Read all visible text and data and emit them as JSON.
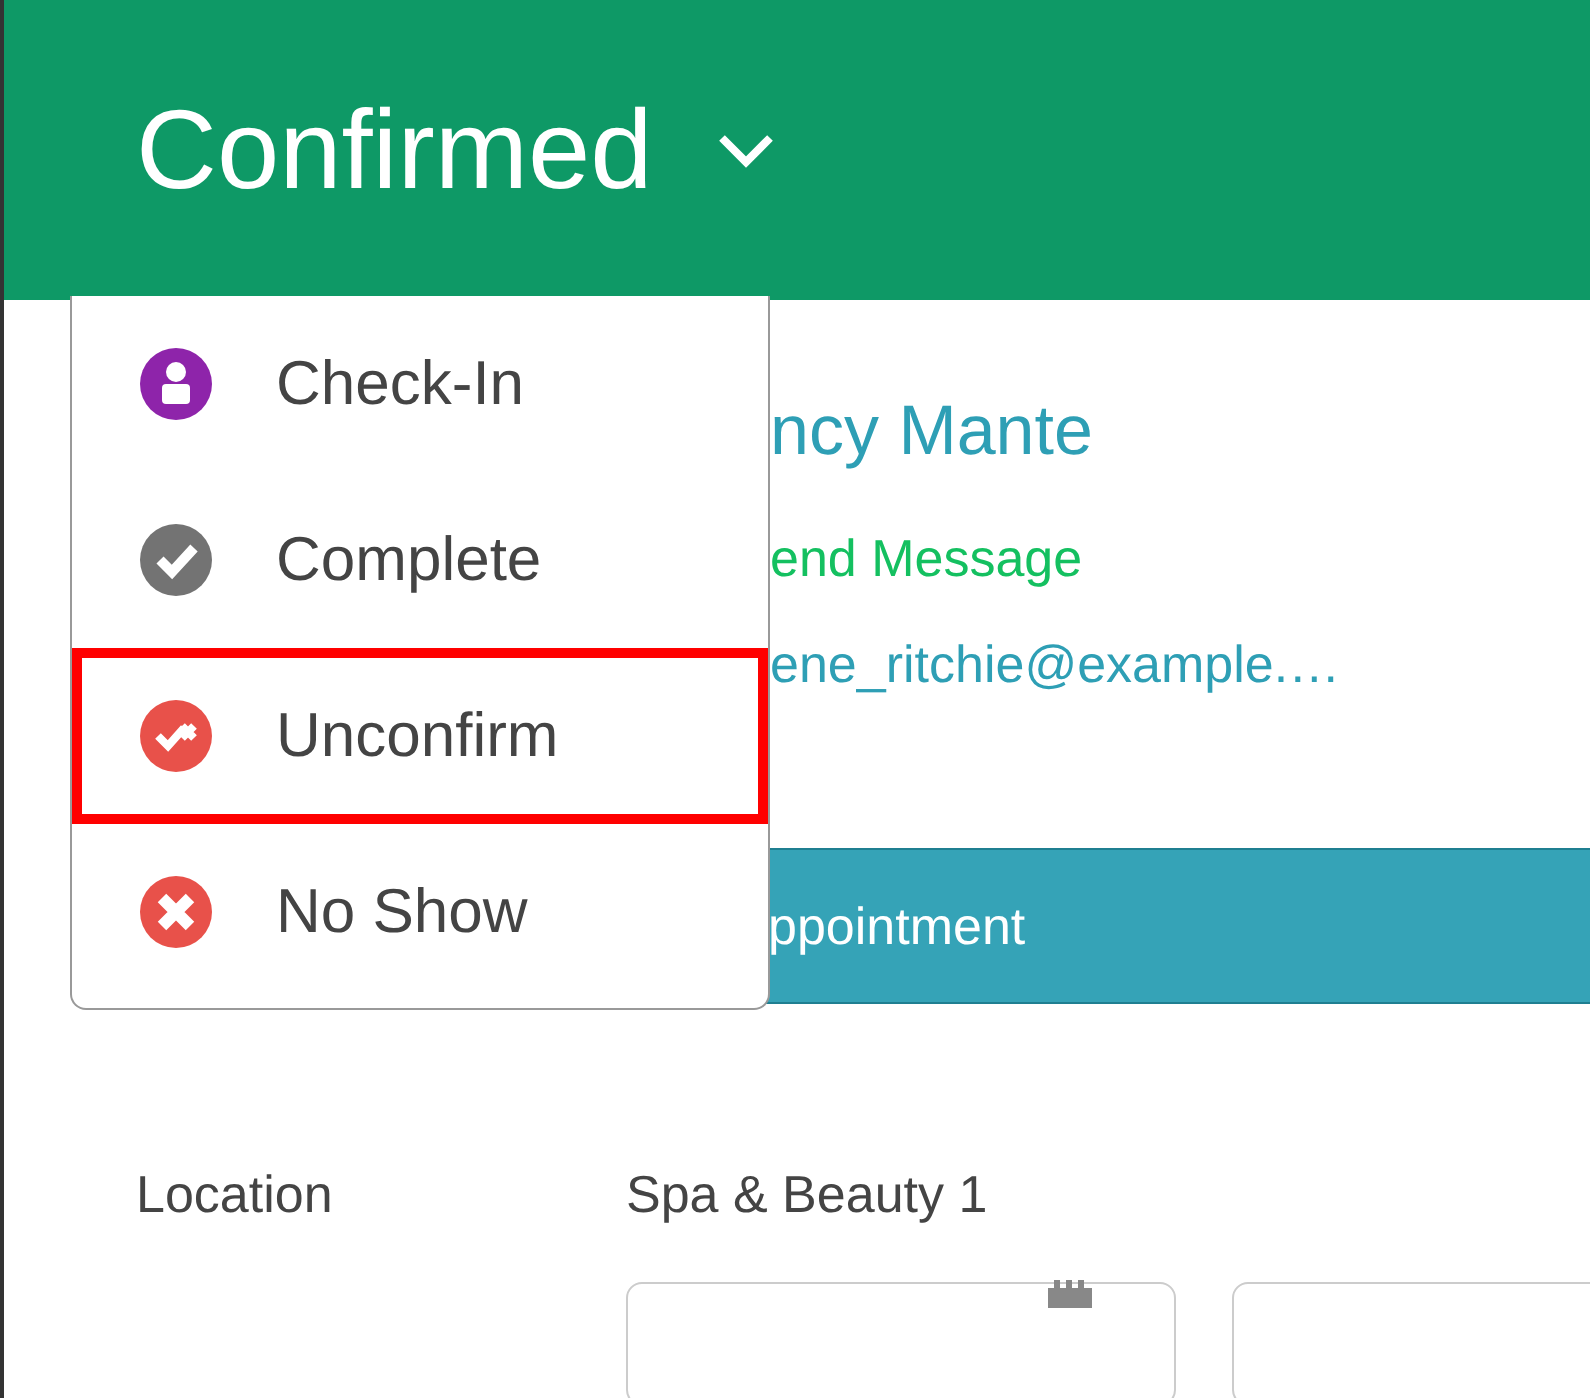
{
  "header": {
    "status": "Confirmed"
  },
  "menu": {
    "items": [
      {
        "label": "Check-In",
        "kind": "person",
        "color": "#8e24aa",
        "highlighted": false
      },
      {
        "label": "Complete",
        "kind": "check",
        "color": "#737373",
        "highlighted": false
      },
      {
        "label": "Unconfirm",
        "kind": "uncheck",
        "color": "#e8514a",
        "highlighted": true
      },
      {
        "label": "No Show",
        "kind": "cross",
        "color": "#e8514a",
        "highlighted": false
      }
    ]
  },
  "client": {
    "name": "ncy Mante",
    "message_link": "end Message",
    "email": "ene_ritchie@example.…"
  },
  "appointment_bar": {
    "label": "ppointment"
  },
  "details": [
    {
      "label": "Location",
      "value": "Spa & Beauty 1"
    }
  ]
}
